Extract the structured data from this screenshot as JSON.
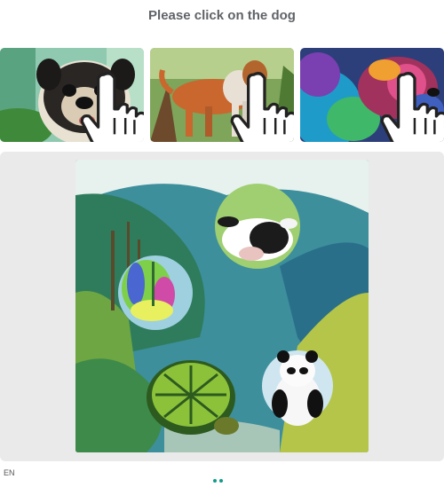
{
  "prompt": {
    "text": "Please click on the dog"
  },
  "examples": [
    {
      "subject": "pug dog",
      "icon": "hand-pointer-icon"
    },
    {
      "subject": "brown dog",
      "icon": "hand-pointer-icon"
    },
    {
      "subject": "colorful dog",
      "icon": "hand-pointer-icon"
    }
  ],
  "challenge": {
    "scene": "watercolor jungle",
    "animals": [
      "cow",
      "dog",
      "turtle",
      "panda"
    ]
  },
  "footer": {
    "left_text": "EN"
  },
  "colors": {
    "prompt_text": "#5f6368",
    "panel_bg": "#eaeaea",
    "accent": "#0f9d8a"
  }
}
